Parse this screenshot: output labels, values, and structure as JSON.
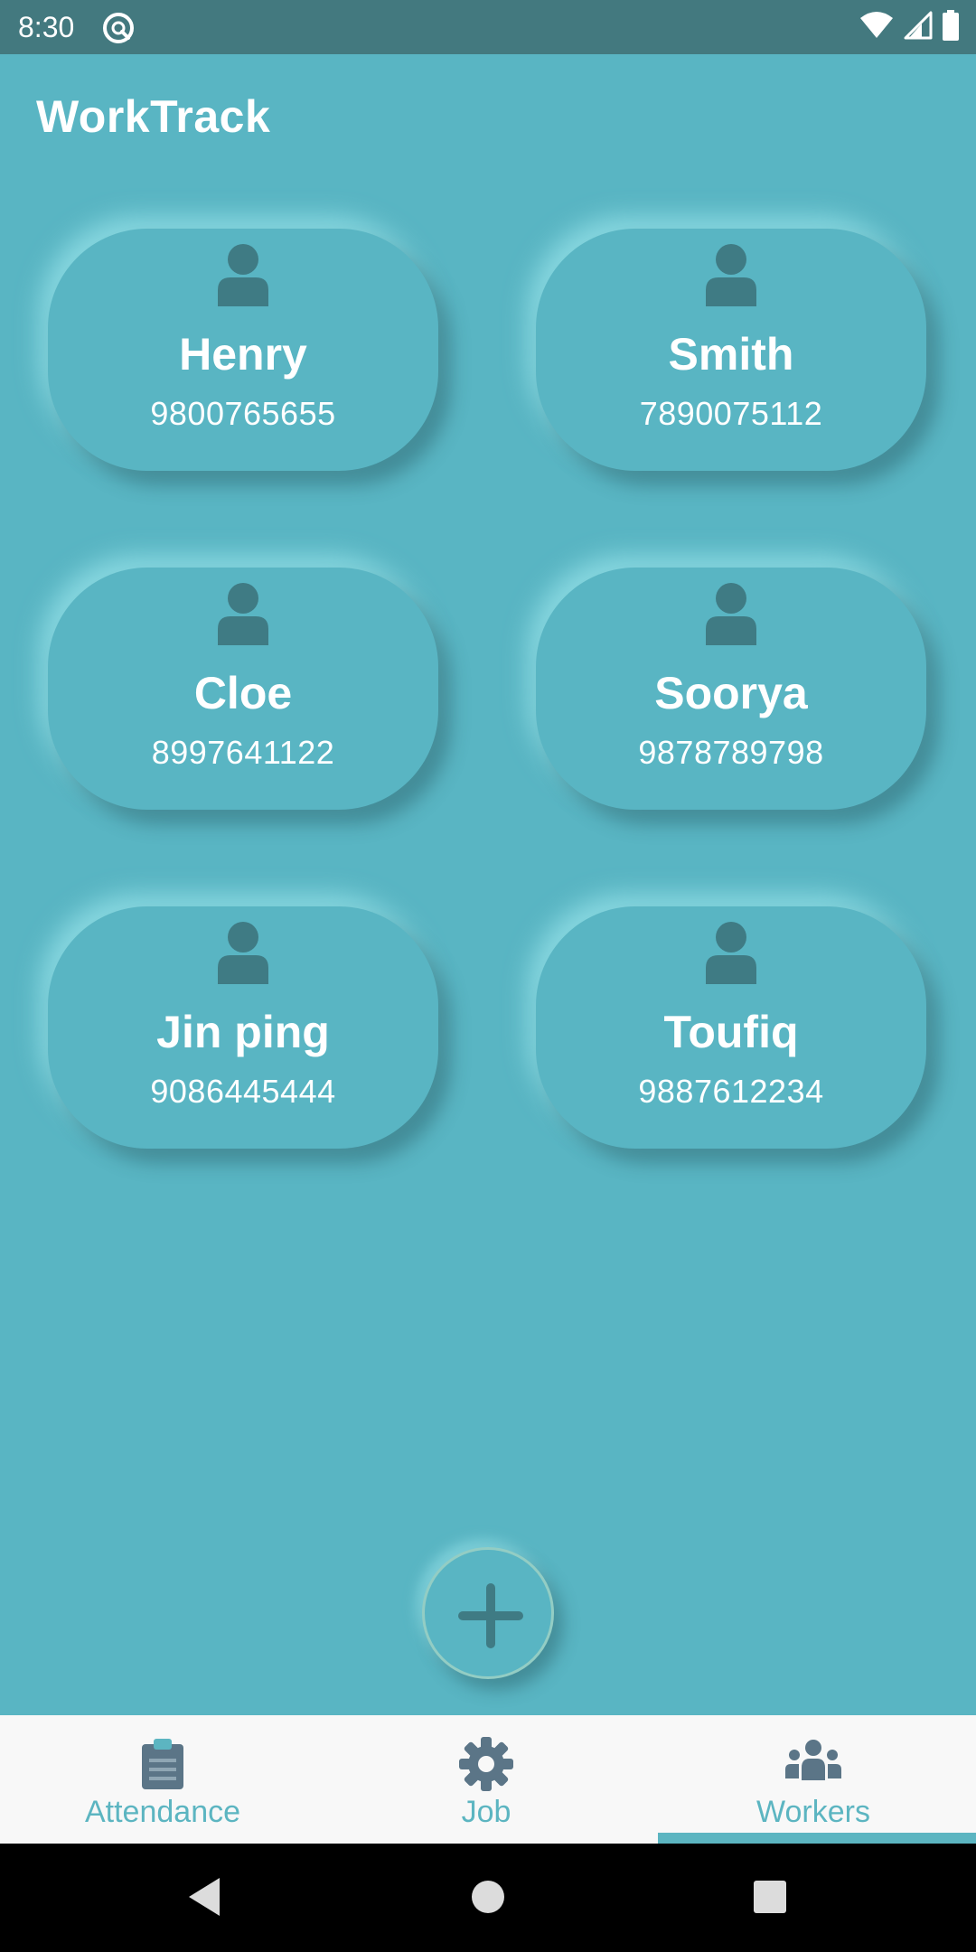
{
  "status_bar": {
    "time": "8:30",
    "icons": [
      "notification-badge-icon",
      "wifi-icon",
      "signal-icon",
      "battery-icon"
    ]
  },
  "app": {
    "title": "WorkTrack"
  },
  "workers": [
    {
      "name": "Henry",
      "phone": "9800765655"
    },
    {
      "name": "Smith",
      "phone": "7890075112"
    },
    {
      "name": "Cloe",
      "phone": "8997641122"
    },
    {
      "name": "Soorya",
      "phone": "9878789798"
    },
    {
      "name": "Jin ping",
      "phone": "9086445444"
    },
    {
      "name": "Toufiq",
      "phone": "9887612234"
    }
  ],
  "fab": {
    "icon": "plus-icon"
  },
  "bottom_nav": {
    "items": [
      {
        "label": "Attendance",
        "icon": "clipboard-icon"
      },
      {
        "label": "Job",
        "icon": "gear-icon"
      },
      {
        "label": "Workers",
        "icon": "group-icon"
      }
    ],
    "selected": "Workers"
  },
  "system_nav": {
    "buttons": [
      "back-icon",
      "home-icon",
      "recents-icon"
    ]
  },
  "colors": {
    "background": "#59b5c3",
    "status_bar": "#43797f",
    "avatar": "#3f7b84",
    "nav_accent": "#5cb5c1",
    "nav_icon": "#5b7587",
    "nav_background": "#f8f8f8"
  }
}
